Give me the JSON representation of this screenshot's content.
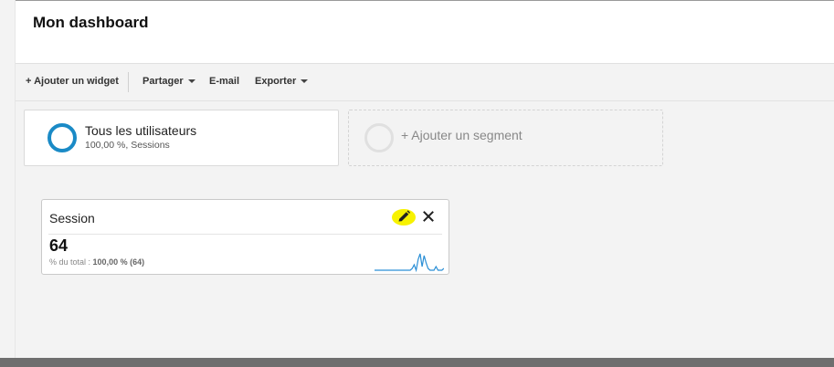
{
  "header": {
    "title": "Mon dashboard"
  },
  "toolbar": {
    "add_widget": "+ Ajouter un widget",
    "share": "Partager",
    "email": "E-mail",
    "export": "Exporter"
  },
  "segments": {
    "active": {
      "name": "Tous les utilisateurs",
      "detail": "100,00 %, Sessions",
      "color": "#1a8ac6"
    },
    "add_label": "+ Ajouter un segment"
  },
  "widget": {
    "title": "Session",
    "value": "64",
    "total_prefix": "% du total :",
    "total_value": "100,00 % (64)",
    "sparkline_color": "#2b8fd6",
    "edit_icon_highlight": "#f7f200",
    "sparkline": [
      0,
      0,
      0,
      0,
      0,
      0,
      0,
      0,
      0,
      0,
      0,
      0,
      0,
      0,
      0,
      0,
      0,
      0,
      0,
      1,
      3,
      0,
      6,
      9,
      2,
      8,
      4,
      1,
      0,
      0,
      0,
      2,
      0,
      0,
      0,
      1
    ]
  }
}
